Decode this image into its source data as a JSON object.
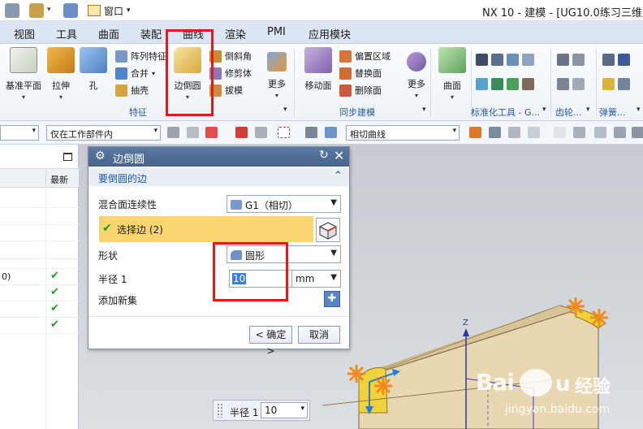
{
  "titlebar": {
    "window_menu_label": "窗口",
    "app_title": "NX 10 - 建模 - [UG10.0练习三维建模"
  },
  "menubar": {
    "tabs": [
      "视图",
      "工具",
      "曲面",
      "装配",
      "曲线",
      "渲染",
      "PMI",
      "应用模块"
    ]
  },
  "ribbon": {
    "datum_plane": "基准平面",
    "extrude": "拉伸",
    "hole": "孔",
    "pattern_feature": "阵列特征",
    "combine": "合并",
    "shell": "抽壳",
    "edge_blend": "边倒圆",
    "chamfer": "倒斜角",
    "trim_body": "修剪体",
    "draft": "拔模",
    "more1": "更多",
    "feature_group": "特征",
    "move_face": "移动面",
    "offset_region": "偏置区域",
    "replace_face": "替换面",
    "delete_face": "删除面",
    "more2": "更多",
    "sync_group": "同步建模",
    "surface": "曲面",
    "standard_tools_group": "标准化工具 - G...",
    "gear_group": "齿轮...",
    "spring_group": "弹簧..."
  },
  "toolbar": {
    "filter_combo": "",
    "scope_combo": "仅在工作部件内",
    "curve_rule_combo": "相切曲线"
  },
  "navigator": {
    "latest_header": "最新",
    "row_fragment": "0)",
    "checks": [
      "✔",
      "✔",
      "✔",
      "✔"
    ]
  },
  "dialog": {
    "title": "边倒圆",
    "section": "要倒圆的边",
    "continuity_label": "混合面连续性",
    "continuity_value": "G1（相切）",
    "select_edge": "选择边 (2)",
    "shape_label": "形状",
    "shape_value": "圆形",
    "radius_label": "半径 1",
    "radius_value": "10",
    "radius_unit": "mm",
    "add_new_set": "添加新集",
    "ok": "< 确定 >",
    "cancel": "取消"
  },
  "viewport": {
    "axis_z": "Z",
    "float_radius_label": "半径 1",
    "float_radius_value": "10"
  },
  "watermark": {
    "brand": "Bai",
    "jingyan": "经验",
    "url": "jingyan.baidu.com"
  },
  "colors": {
    "accent": "#e01b1b",
    "selection": "#f8d56f",
    "dialog_title": "#4f6f99",
    "check": "#1e9d1e"
  }
}
